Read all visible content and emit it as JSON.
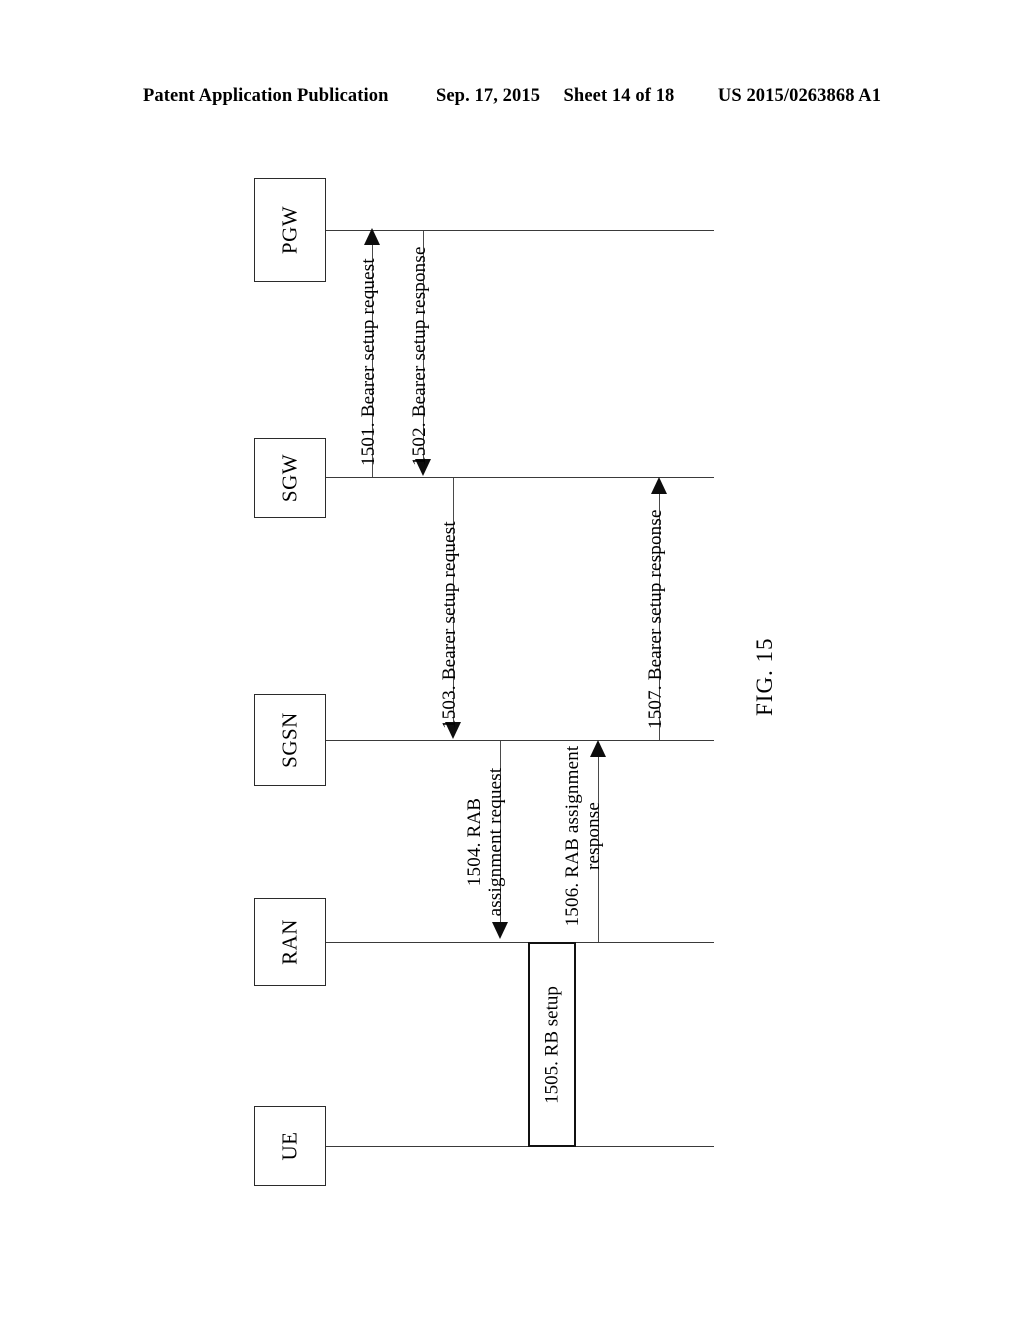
{
  "header": {
    "publication": "Patent Application Publication",
    "date": "Sep. 17, 2015",
    "sheet": "Sheet 14 of 18",
    "patent_number": "US 2015/0263868 A1"
  },
  "figure": {
    "caption": "FIG. 15",
    "participants": [
      {
        "id": "pgw",
        "label": "PGW"
      },
      {
        "id": "sgw",
        "label": "SGW"
      },
      {
        "id": "sgsn",
        "label": "SGSN"
      },
      {
        "id": "ran",
        "label": "RAN"
      },
      {
        "id": "ue",
        "label": "UE"
      }
    ],
    "messages": [
      {
        "id": "1501",
        "label": "1501. Bearer setup request",
        "from": "sgw",
        "to": "pgw",
        "direction": "up"
      },
      {
        "id": "1502",
        "label": "1502. Bearer setup response",
        "from": "pgw",
        "to": "sgw",
        "direction": "down"
      },
      {
        "id": "1503",
        "label": "1503. Bearer setup request",
        "from": "sgw",
        "to": "sgsn",
        "direction": "down"
      },
      {
        "id": "1504",
        "label": "1504. RAB assignment request",
        "from": "sgsn",
        "to": "ran",
        "direction": "down"
      },
      {
        "id": "1505",
        "label": "1505. RB setup",
        "from": "ran",
        "to": "ue",
        "direction": "box"
      },
      {
        "id": "1506",
        "label": "1506. RAB assignment response",
        "from": "ran",
        "to": "sgsn",
        "direction": "up"
      },
      {
        "id": "1507",
        "label": "1507. Bearer setup response",
        "from": "sgsn",
        "to": "sgw",
        "direction": "up"
      }
    ]
  },
  "colors": {
    "ink": "#000000",
    "line": "#3a3a3a",
    "box_border": "#2b2b2b",
    "background": "#ffffff"
  }
}
